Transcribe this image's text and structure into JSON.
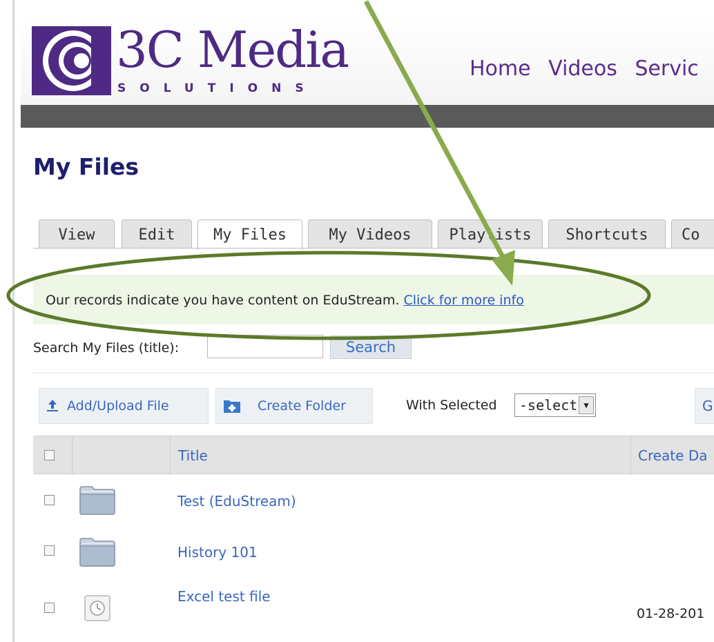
{
  "brand": {
    "name": "3C Media",
    "tagline": "SOLUTIONS",
    "color": "#4e2a84"
  },
  "main_nav": [
    "Home",
    "Videos",
    "Servic"
  ],
  "page_title": "My Files",
  "tabs": [
    "View",
    "Edit",
    "My Files",
    "My Videos",
    "Playlists",
    "Shortcuts",
    "Co"
  ],
  "active_tab": "My Files",
  "notice": {
    "text": "Our records indicate you have content on EduStream.",
    "link": "Click for more info"
  },
  "search": {
    "label": "Search My Files (title):",
    "value": "",
    "button": "Search"
  },
  "toolbar": {
    "add_upload": "Add/Upload File",
    "create_folder": "Create Folder",
    "with_selected_label": "With Selected",
    "select_value": "-select-",
    "go_label": "G"
  },
  "table": {
    "headers": {
      "title": "Title",
      "create_date": "Create Da"
    },
    "rows": [
      {
        "type": "folder",
        "title": "Test (EduStream)",
        "date": ""
      },
      {
        "type": "folder",
        "title": "History 101",
        "date": ""
      },
      {
        "type": "file",
        "title": "Excel test file",
        "date": "01-28-201"
      }
    ]
  },
  "annotation": {
    "arrow_color": "#8aab4c",
    "ellipse_color": "#5b7a2a"
  }
}
